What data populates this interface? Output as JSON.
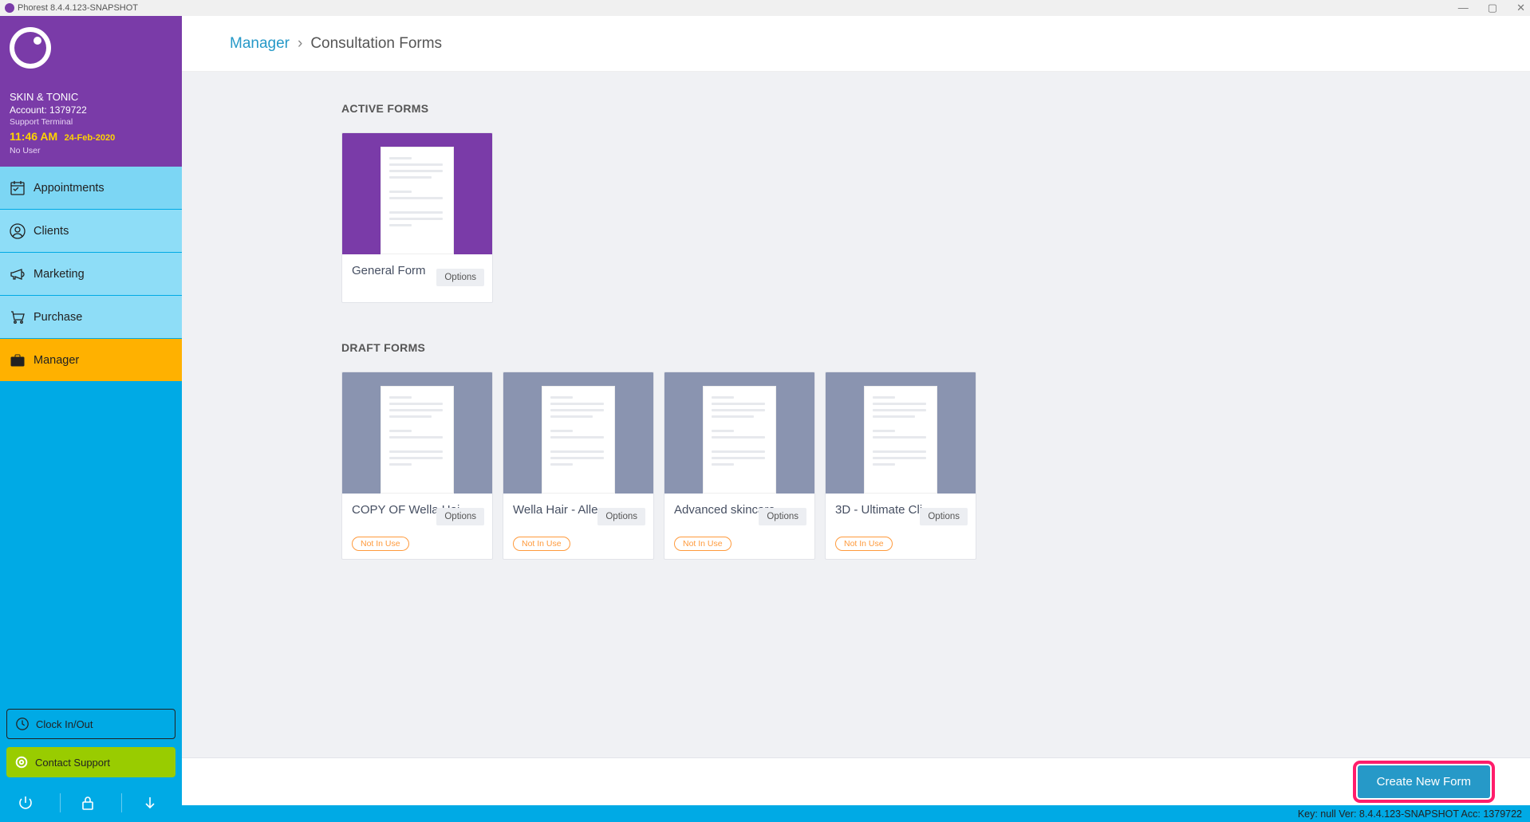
{
  "window": {
    "title": "Phorest 8.4.4.123-SNAPSHOT"
  },
  "sidebar": {
    "business": "SKIN & TONIC",
    "account": "Account: 1379722",
    "terminal": "Support Terminal",
    "time": "11:46 AM",
    "date": "24-Feb-2020",
    "user": "No User",
    "nav": [
      {
        "label": "Appointments"
      },
      {
        "label": "Clients"
      },
      {
        "label": "Marketing"
      },
      {
        "label": "Purchase"
      },
      {
        "label": "Manager"
      }
    ],
    "clock": "Clock In/Out",
    "support": "Contact Support"
  },
  "breadcrumb": {
    "root": "Manager",
    "current": "Consultation Forms"
  },
  "sections": {
    "active_title": "ACTIVE FORMS",
    "draft_title": "DRAFT FORMS"
  },
  "active_forms": [
    {
      "title": "General Form",
      "options": "Options"
    }
  ],
  "draft_forms": [
    {
      "title": "COPY OF Wella Hai...",
      "options": "Options",
      "badge": "Not In Use"
    },
    {
      "title": "Wella Hair - Alle...",
      "options": "Options",
      "badge": "Not In Use"
    },
    {
      "title": "Advanced skincare",
      "options": "Options",
      "badge": "Not In Use"
    },
    {
      "title": "3D - Ultimate Cli...",
      "options": "Options",
      "badge": "Not In Use"
    }
  ],
  "buttons": {
    "create": "Create New Form"
  },
  "status": "Key: null Ver: 8.4.4.123-SNAPSHOT Acc: 1379722"
}
